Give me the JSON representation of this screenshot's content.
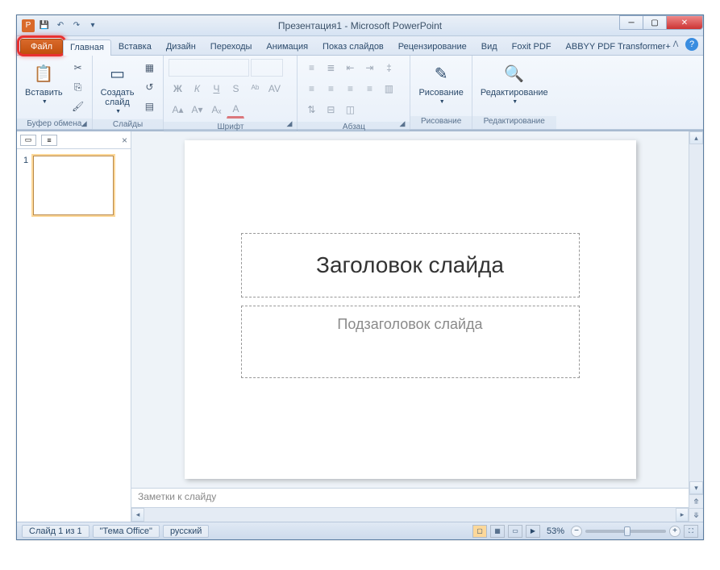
{
  "titlebar": {
    "title": "Презентация1 - Microsoft PowerPoint"
  },
  "qat": {
    "save": "💾",
    "undo": "↶",
    "redo": "↷"
  },
  "tabs": {
    "file": "Файл",
    "items": [
      "Главная",
      "Вставка",
      "Дизайн",
      "Переходы",
      "Анимация",
      "Показ слайдов",
      "Рецензирование",
      "Вид",
      "Foxit PDF",
      "ABBYY PDF Transformer+"
    ],
    "active_index": 0
  },
  "ribbon": {
    "clipboard": {
      "paste": "Вставить",
      "label": "Буфер обмена"
    },
    "slides": {
      "new_slide": "Создать\nслайд",
      "label": "Слайды"
    },
    "font": {
      "label": "Шрифт"
    },
    "paragraph": {
      "label": "Абзац"
    },
    "drawing": {
      "label": "Рисование",
      "btn": "Рисование"
    },
    "editing": {
      "label": "Редактирование",
      "btn": "Редактирование"
    }
  },
  "slidepanel": {
    "thumb_number": "1"
  },
  "slide": {
    "title_placeholder": "Заголовок слайда",
    "subtitle_placeholder": "Подзаголовок слайда"
  },
  "notes": {
    "placeholder": "Заметки к слайду"
  },
  "statusbar": {
    "slide_info": "Слайд 1 из 1",
    "theme": "\"Тема Office\"",
    "language": "русский",
    "zoom": "53%"
  }
}
